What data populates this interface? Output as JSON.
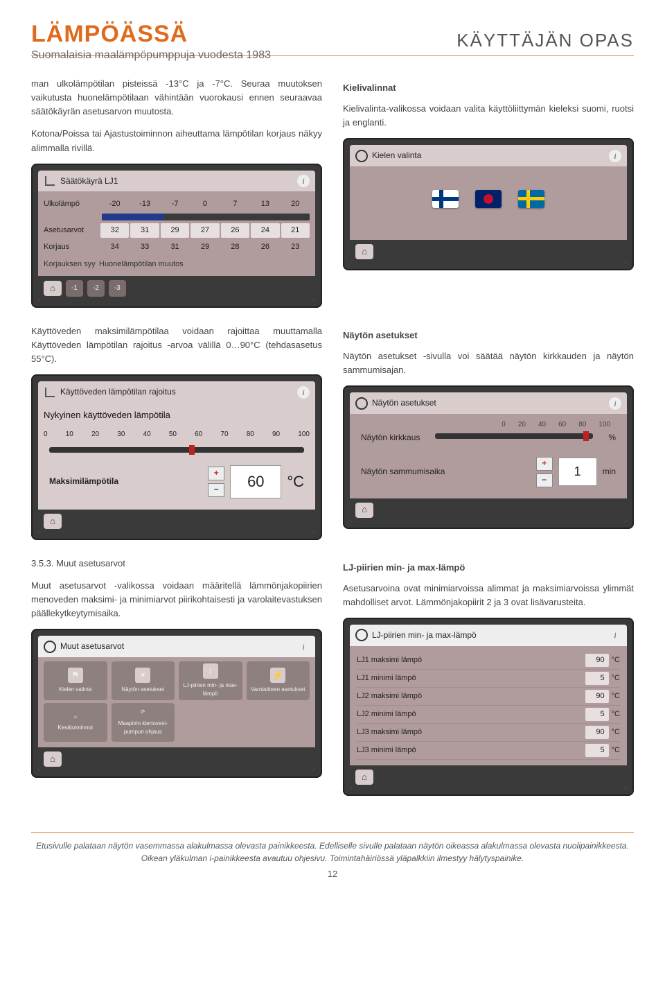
{
  "header": {
    "brand": "LÄMPÖÄSSÄ",
    "tagline": "Suomalaisia maalämpöpumppuja vuodesta 1983",
    "doc_title": "KÄYTTÄJÄN OPAS"
  },
  "left": {
    "p1": "man ulkolämpötilan pisteissä -13°C ja -7°C. Seuraa muutoksen vaikutusta huonelämpötilaan vähintään vuorokausi ennen seuraavaa säätökäyrän asetusarvon muutosta.",
    "p2": "Kotona/Poissa tai Ajastustoiminnon aiheuttama lämpötilan korjaus näkyy alimmalla rivillä.",
    "p3": "Käyttöveden maksimilämpötilaa voidaan rajoittaa muuttamalla Käyttöveden lämpötilan rajoitus -arvoa välillä 0…90°C (tehdasasetus 55°C).",
    "sec353_title": "3.5.3. Muut asetusarvot",
    "sec353_body": "Muut asetusarvot -valikossa voidaan määritellä lämmönjakopiirien menoveden maksimi- ja minimiarvot piirikohtaisesti ja varolaitevastuksen päällekytkeytymisaika."
  },
  "right": {
    "kieli_title": "Kielivalinnat",
    "kieli_body": "Kielivalinta-valikossa voidaan valita käyttöliittymän kieleksi suomi, ruotsi ja englanti.",
    "nayton_title": "Näytön asetukset",
    "nayton_body": "Näytön asetukset -sivulla voi säätää näytön kirkkauden ja näytön sammumisajan.",
    "lj_title": "LJ-piirien min- ja max-lämpö",
    "lj_body": "Asetusarvoina ovat minimiarvoissa alimmat ja maksimiarvoissa ylimmät mahdolliset arvot. Lämmönjakopiirit 2 ja 3 ovat lisävarusteita."
  },
  "ui_saatokayra": {
    "title": "Säätökäyrä LJ1",
    "row_ulko": "Ulkolämpö",
    "headers": [
      "-20",
      "-13",
      "-7",
      "0",
      "7",
      "13",
      "20"
    ],
    "row_aset": "Asetusarvot",
    "aset_vals": [
      "32",
      "31",
      "29",
      "27",
      "26",
      "24",
      "21"
    ],
    "row_korj": "Korjaus",
    "korj_vals": [
      "34",
      "33",
      "31",
      "29",
      "28",
      "26",
      "23"
    ],
    "row_syy": "Korjauksen syy",
    "syy_val": "Huonelämpötilan muutos",
    "chips": [
      "-1",
      "-2",
      "-3"
    ]
  },
  "ui_kayttovesi": {
    "title": "Käyttöveden lämpötilan rajoitus",
    "sub": "Nykyinen käyttöveden lämpötila",
    "ticks": [
      "0",
      "10",
      "20",
      "30",
      "40",
      "50",
      "60",
      "70",
      "80",
      "90",
      "100"
    ],
    "label": "Maksimilämpötila",
    "value": "60",
    "unit": "°C"
  },
  "ui_kielen": {
    "title": "Kielen valinta"
  },
  "ui_nayton": {
    "title": "Näytön asetukset",
    "ticks": [
      "0",
      "20",
      "40",
      "60",
      "80",
      "100"
    ],
    "kirk_label": "Näytön kirkkaus",
    "kirk_unit": "%",
    "sammu_label": "Näytön sammumisaika",
    "sammu_val": "1",
    "sammu_unit": "min"
  },
  "ui_muut": {
    "title": "Muut asetusarvot",
    "items": [
      {
        "label": "Kielen valinta"
      },
      {
        "label": "Näytön asetukset"
      },
      {
        "label": "LJ-piirien min- ja max-lämpö"
      },
      {
        "label": "Varolaitteen asetukset"
      },
      {
        "label": "Kesätoiminnot"
      },
      {
        "label": "Maapiirin kiertovesi-pumpun ohjaus"
      }
    ]
  },
  "ui_lj": {
    "title": "LJ-piirien min- ja max-lämpö",
    "unit": "°C",
    "rows": [
      {
        "label": "LJ1 maksimi lämpö",
        "val": "90"
      },
      {
        "label": "LJ1 minimi lämpö",
        "val": "5"
      },
      {
        "label": "LJ2 maksimi lämpö",
        "val": "90"
      },
      {
        "label": "LJ2 minimi lämpö",
        "val": "5"
      },
      {
        "label": "LJ3 maksimi lämpö",
        "val": "90"
      },
      {
        "label": "LJ3 minimi lämpö",
        "val": "5"
      }
    ]
  },
  "footer": {
    "note": "Etusivulle palataan näytön vasemmassa alakulmassa olevasta painikkeesta. Edelliselle sivulle palataan näytön oikeassa alakulmassa olevasta nuolipainikkeesta. Oikean yläkulman i-painikkeesta avautuu ohjesivu. Toimintahäiriössä yläpalkkiin ilmestyy hälytyspainike.",
    "page": "12"
  }
}
